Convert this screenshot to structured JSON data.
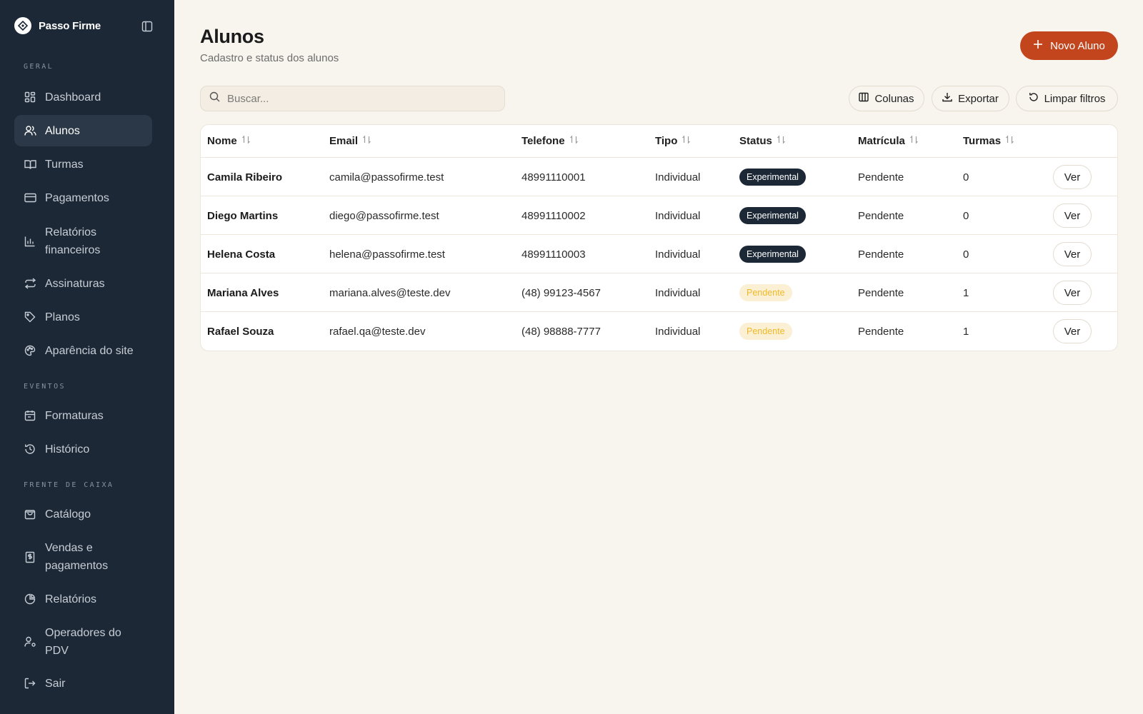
{
  "app": {
    "name": "Passo Firme"
  },
  "sidebar": {
    "sections": {
      "geral": "GERAL",
      "eventos": "EVENTOS",
      "frente": "FRENTE DE CAIXA"
    },
    "items": [
      {
        "label": "Dashboard",
        "icon": "dashboard-icon"
      },
      {
        "label": "Alunos",
        "icon": "users-icon",
        "active": true
      },
      {
        "label": "Turmas",
        "icon": "book-icon"
      },
      {
        "label": "Pagamentos",
        "icon": "credit-card-icon"
      },
      {
        "label": "Relatórios financeiros",
        "icon": "bar-chart-icon"
      },
      {
        "label": "Assinaturas",
        "icon": "repeat-icon"
      },
      {
        "label": "Planos",
        "icon": "tag-icon"
      },
      {
        "label": "Aparência do site",
        "icon": "palette-icon"
      },
      {
        "label": "Formaturas",
        "icon": "calendar-icon"
      },
      {
        "label": "Histórico",
        "icon": "history-icon"
      },
      {
        "label": "Catálogo",
        "icon": "shopping-bag-icon"
      },
      {
        "label": "Vendas e pagamentos",
        "icon": "receipt-icon"
      },
      {
        "label": "Relatórios",
        "icon": "pie-chart-icon"
      },
      {
        "label": "Operadores do PDV",
        "icon": "user-cog-icon"
      },
      {
        "label": "Sair",
        "icon": "logout-icon"
      }
    ]
  },
  "header": {
    "title": "Alunos",
    "subtitle": "Cadastro e status dos alunos",
    "new_button": "Novo Aluno"
  },
  "toolbar": {
    "search_placeholder": "Buscar...",
    "columns_button": "Colunas",
    "export_button": "Exportar",
    "clear_button": "Limpar filtros"
  },
  "table": {
    "columns": [
      "Nome",
      "Email",
      "Telefone",
      "Tipo",
      "Status",
      "Matrícula",
      "Turmas"
    ],
    "action_label": "Ver",
    "rows": [
      {
        "nome": "Camila Ribeiro",
        "email": "camila@passofirme.test",
        "telefone": "48991110001",
        "tipo": "Individual",
        "status": "Experimental",
        "matricula": "Pendente",
        "turmas": "0"
      },
      {
        "nome": "Diego Martins",
        "email": "diego@passofirme.test",
        "telefone": "48991110002",
        "tipo": "Individual",
        "status": "Experimental",
        "matricula": "Pendente",
        "turmas": "0"
      },
      {
        "nome": "Helena Costa",
        "email": "helena@passofirme.test",
        "telefone": "48991110003",
        "tipo": "Individual",
        "status": "Experimental",
        "matricula": "Pendente",
        "turmas": "0"
      },
      {
        "nome": "Mariana Alves",
        "email": "mariana.alves@teste.dev",
        "telefone": "(48) 99123-4567",
        "tipo": "Individual",
        "status": "Pendente",
        "matricula": "Pendente",
        "turmas": "1"
      },
      {
        "nome": "Rafael Souza",
        "email": "rafael.qa@teste.dev",
        "telefone": "(48) 98888-7777",
        "tipo": "Individual",
        "status": "Pendente",
        "matricula": "Pendente",
        "turmas": "1"
      }
    ]
  },
  "colors": {
    "sidebar_bg": "#1c2836",
    "accent": "#c2451e",
    "page_bg": "#f8f4ee",
    "badge_experimental": "#1c2836",
    "badge_pendente_bg": "#fbf0d4",
    "badge_pendente_text": "#f0b92a"
  }
}
